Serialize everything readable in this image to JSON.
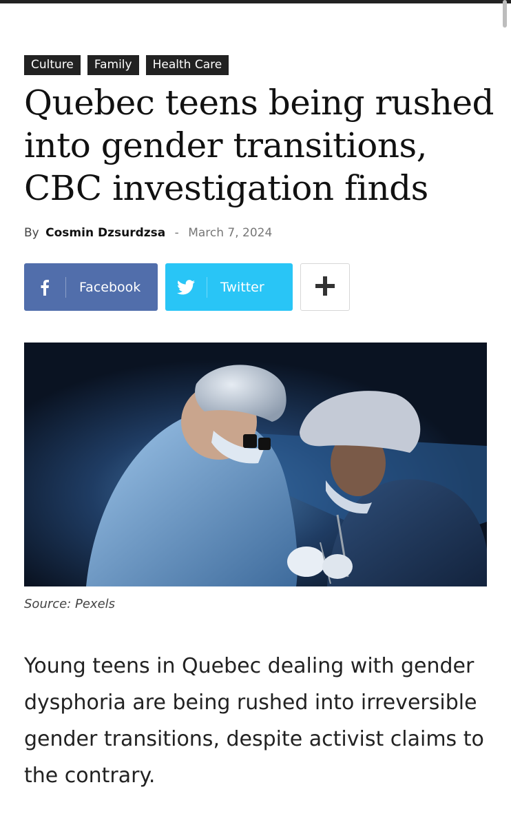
{
  "article": {
    "tags": [
      "Culture",
      "Family",
      "Health Care"
    ],
    "headline": "Quebec teens being rushed into gender transitions, CBC investigation finds",
    "byline": {
      "by": "By",
      "author": "Cosmin Dzsurdzsa",
      "separator": "-",
      "date": "March 7, 2024"
    },
    "share": {
      "facebook": {
        "label": "Facebook",
        "icon": "facebook-icon",
        "color": "#516eab"
      },
      "twitter": {
        "label": "Twitter",
        "icon": "twitter-bird-icon",
        "color": "#29c5f6"
      },
      "more": {
        "icon": "plus-icon"
      }
    },
    "image": {
      "subject": "surgeons in surgical caps and masks operating"
    },
    "caption": "Source: Pexels",
    "lede": "Young teens in Quebec dealing with gender dysphoria are being rushed into irreversible gender transitions, despite activist claims to the contrary."
  }
}
